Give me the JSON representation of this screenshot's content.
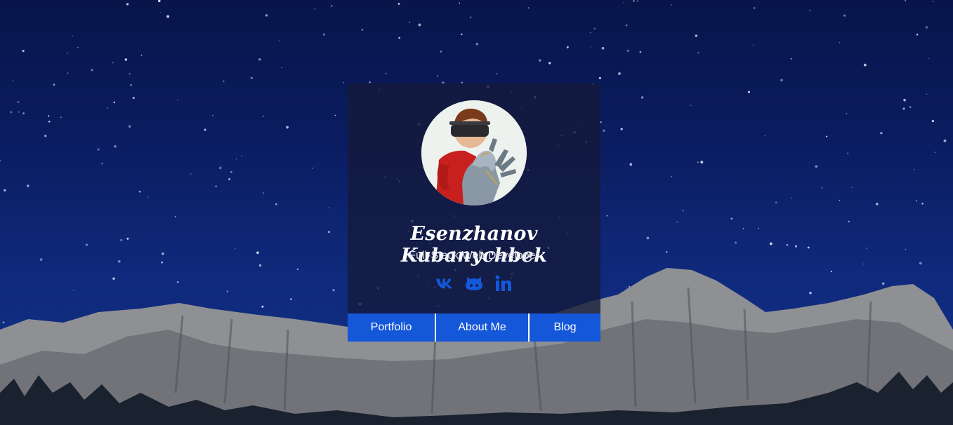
{
  "profile": {
    "name": "Esenzhanov Kubanychbek",
    "title": "Full-Stack Web Developer",
    "avatar": "avatar-illustration"
  },
  "socials": [
    {
      "icon": "vk-icon",
      "color": "#1557d9"
    },
    {
      "icon": "github-icon",
      "color": "#1557d9"
    },
    {
      "icon": "linkedin-icon",
      "color": "#1557d9"
    }
  ],
  "nav": [
    {
      "label": "Portfolio"
    },
    {
      "label": "About Me"
    },
    {
      "label": "Blog"
    }
  ],
  "colors": {
    "accent": "#1557d9",
    "sky": "#0b1d62",
    "card": "#141a3a"
  }
}
